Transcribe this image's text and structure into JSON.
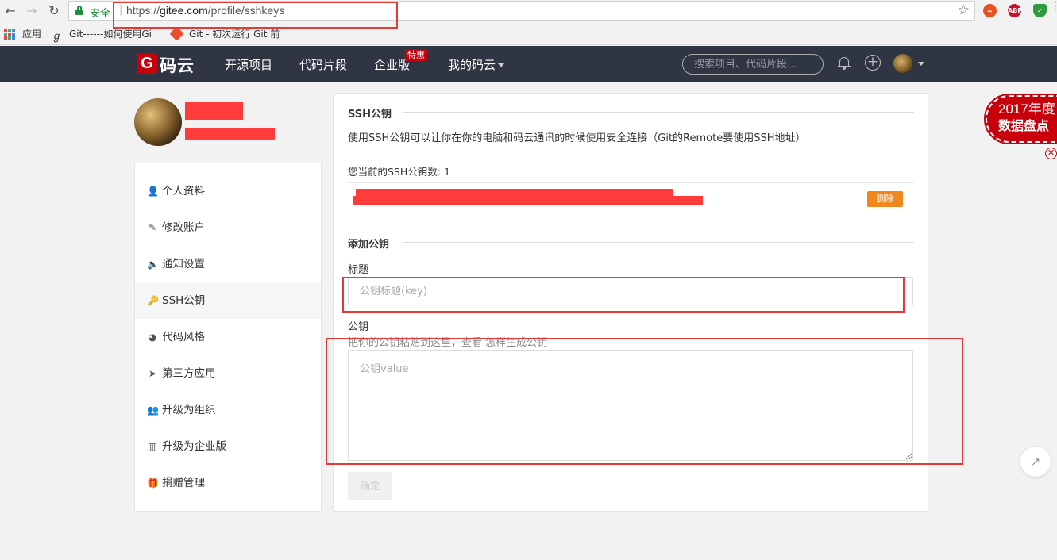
{
  "browser": {
    "back_glyph": "←",
    "forward_glyph": "→",
    "reload_glyph": "↻",
    "secure_label": "安全",
    "url_scheme": "https://",
    "url_host": "gitee.com",
    "url_path": "/profile/sshkeys",
    "star_glyph": "☆",
    "menu_glyph": "⋮",
    "extensions": [
      {
        "name": "infinity-extension-icon",
        "label": "∞"
      },
      {
        "name": "adblock-plus-icon",
        "label": "ABP"
      },
      {
        "name": "shield-extension-icon",
        "label": "✓"
      }
    ]
  },
  "bookmarks": {
    "apps_label": "应用",
    "items": [
      "Git------如何使用Gi",
      "Git - 初次运行 Git 前"
    ]
  },
  "header": {
    "logo_mark": "G",
    "logo_text": "码云",
    "nav": [
      "开源项目",
      "代码片段",
      "企业版",
      "我的码云"
    ],
    "badge": "特惠",
    "search_placeholder": "搜索项目、代码片段..."
  },
  "sidebar": {
    "items": [
      {
        "label": "个人资料",
        "icon": "user-icon",
        "glyph": "👤"
      },
      {
        "label": "修改账户",
        "icon": "pencil-icon",
        "glyph": "✎"
      },
      {
        "label": "通知设置",
        "icon": "volume-icon",
        "glyph": "🔈"
      },
      {
        "label": "SSH公钥",
        "icon": "key-icon",
        "glyph": "🔑"
      },
      {
        "label": "代码风格",
        "icon": "dashboard-icon",
        "glyph": "◕"
      },
      {
        "label": "第三方应用",
        "icon": "rocket-icon",
        "glyph": "➤"
      },
      {
        "label": "升级为组织",
        "icon": "users-icon",
        "glyph": "👥"
      },
      {
        "label": "升级为企业版",
        "icon": "building-icon",
        "glyph": "▥"
      },
      {
        "label": "捐赠管理",
        "icon": "gift-icon",
        "glyph": "🎁"
      }
    ],
    "active_index": 3
  },
  "main": {
    "ssh_section_title": "SSH公钥",
    "description": "使用SSH公钥可以让你在你的电脑和码云通讯的时候使用安全连接（Git的Remote要使用SSH地址）",
    "key_count_label": "您当前的SSH公钥数:",
    "key_count": "1",
    "delete_label": "删除",
    "add_section_title": "添加公钥",
    "title_label": "标题",
    "title_placeholder": "公钥标题(key)",
    "key_label": "公钥",
    "key_hint": "把你的公钥粘贴到这里，查看 ",
    "key_hint_link": "怎样生成公钥",
    "key_placeholder": "公钥value",
    "confirm_label": "确定"
  },
  "promo": {
    "line1": "2017年度",
    "line2": "数据盘点",
    "close_glyph": "✕"
  },
  "share_glyph": "↗",
  "colors": {
    "header_bg": "#2f3542",
    "brand_red": "#c7000b",
    "delete_orange": "#f0861c",
    "annotation_red": "#e53935",
    "redaction_red": "#ff3b3b"
  }
}
